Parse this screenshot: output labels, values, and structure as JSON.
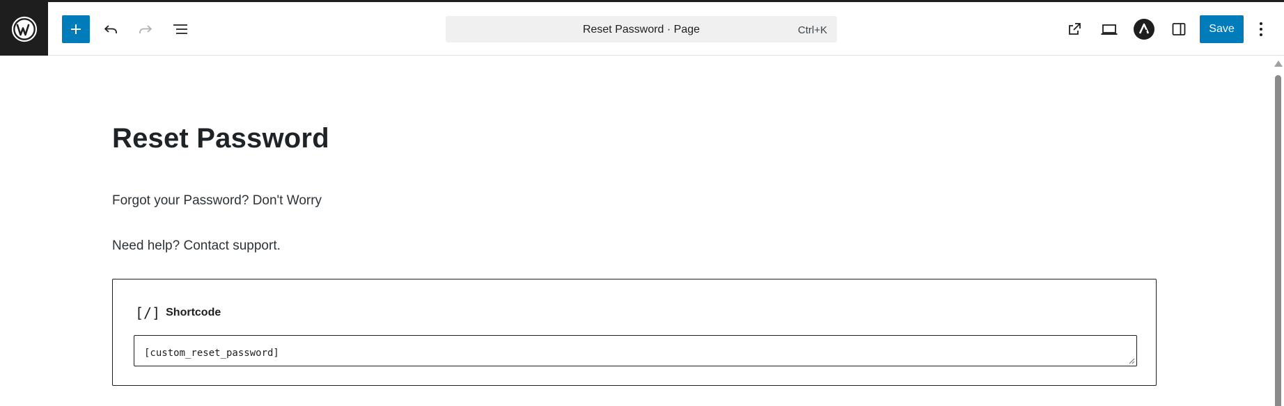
{
  "header": {
    "command_bar": {
      "title": "Reset Password · Page",
      "shortcut": "Ctrl+K"
    },
    "save_label": "Save",
    "icons": {
      "logo": "wordpress-logo-icon",
      "inserter": "plus-icon",
      "undo": "undo-icon",
      "redo": "redo-icon",
      "document_overview": "list-view-icon",
      "view_page": "external-link-icon",
      "preview": "laptop-icon",
      "plugin": "astra-icon",
      "settings": "sidebar-toggle-icon",
      "options": "more-vertical-icon"
    },
    "accent_color": "#007cba"
  },
  "content": {
    "title": "Reset Password",
    "paragraphs": [
      "Forgot your Password? Don't Worry",
      "Need help? Contact support."
    ],
    "shortcode_block": {
      "icon_glyph": "[/]",
      "label": "Shortcode",
      "value": "[custom_reset_password]"
    }
  }
}
